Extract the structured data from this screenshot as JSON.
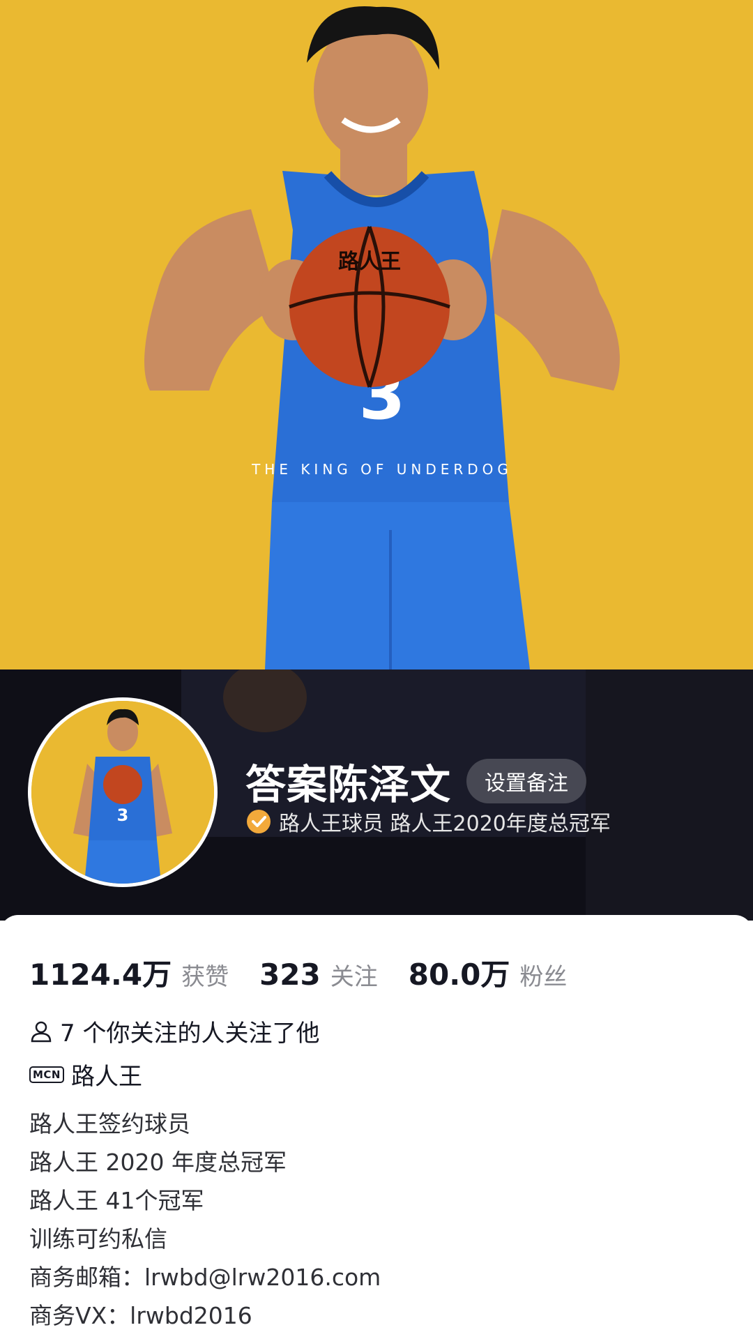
{
  "profile": {
    "display_name": "答案陈泽文",
    "remark_button": "设置备注",
    "verification": "路人王球员  路人王2020年度总冠军",
    "verification_icon": "verified-check-icon",
    "jersey_brand": "路人王",
    "jersey_number": "3",
    "jersey_slogan": "THE KING OF UNDERDOG",
    "ball_text": "路人王"
  },
  "stats": [
    {
      "value": "1124.4万",
      "label": "获赞"
    },
    {
      "value": "323",
      "label": "关注"
    },
    {
      "value": "80.0万",
      "label": "粉丝"
    }
  ],
  "mutual": {
    "icon": "person-icon",
    "text": "7 个你关注的人关注了他"
  },
  "mcn": {
    "badge": "MCN",
    "text": "路人王"
  },
  "bio": [
    "路人王签约球员",
    "路人王 2020 年度总冠军",
    "路人王 41个冠军",
    "训练可约私信",
    "商务邮箱：lrwbd@lrw2016.com",
    "商务VX：lrwbd2016"
  ],
  "colors": {
    "hero_background": "#eab931",
    "jersey_blue": "#2a6fd6",
    "verify_orange": "#f2a93b",
    "header_band": "#0f0f17"
  }
}
